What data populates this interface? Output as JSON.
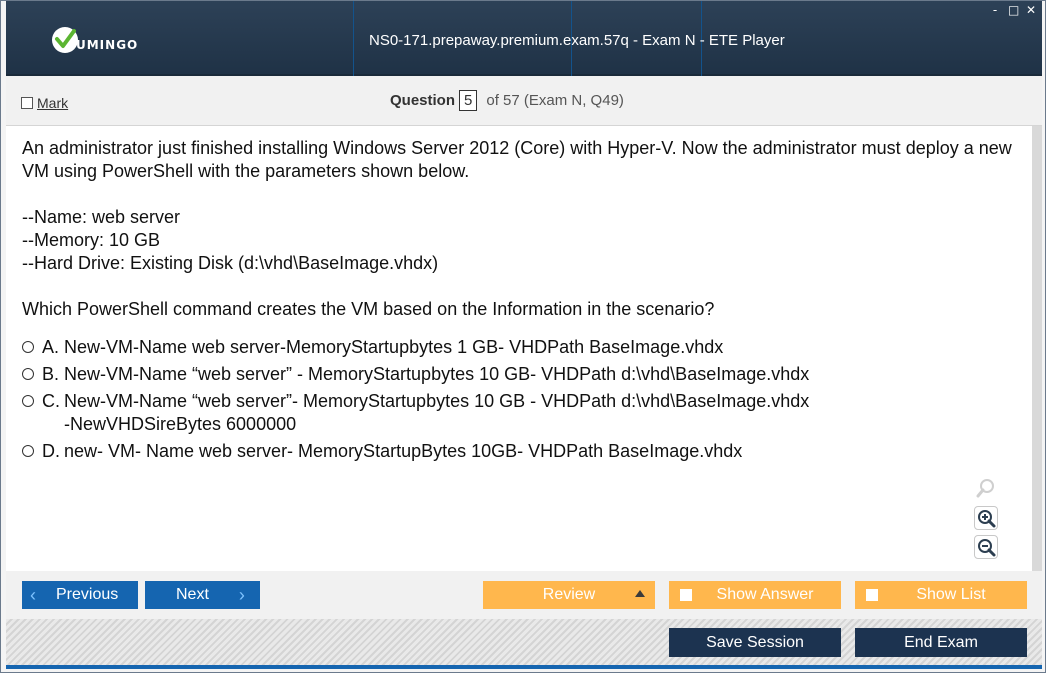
{
  "window": {
    "title": "NS0-171.prepaway.premium.exam.57q - Exam N - ETE Player",
    "logo_text": "UMINGO",
    "controls": [
      "-",
      "□",
      "✕"
    ]
  },
  "header": {
    "mark_label": "Mark",
    "question_label": "Question",
    "question_number": "5",
    "question_rest": "of 57 (Exam N, Q49)"
  },
  "question": {
    "text": "An administrator just finished installing Windows Server 2012 (Core) with Hyper-V. Now the administrator must deploy a new VM using PowerShell with the parameters shown below.\n\n--Name: web server\n--Memory: 10 GB\n--Hard Drive: Existing Disk (d:\\vhd\\BaseImage.vhdx)\n\nWhich PowerShell command creates the VM based on the Information in the scenario?",
    "answers": [
      {
        "letter": "A.",
        "text": "New-VM-Name web server-MemoryStartupbytes 1 GB- VHDPath BaseImage.vhdx"
      },
      {
        "letter": "B.",
        "text": "New-VM-Name “web server” - MemoryStartupbytes 10 GB- VHDPath d:\\vhd\\BaseImage.vhdx"
      },
      {
        "letter": "C.",
        "text": "New-VM-Name “web server”- MemoryStartupbytes 10 GB - VHDPath d:\\vhd\\BaseImage.vhdx\n-NewVHDSireBytes 6000000"
      },
      {
        "letter": "D.",
        "text": "new- VM- Name web server- MemoryStartupBytes 10GB- VHDPath BaseImage.vhdx"
      }
    ]
  },
  "nav": {
    "previous_label": "Previous",
    "next_label": "Next",
    "review_label": "Review",
    "show_answer_label": "Show Answer",
    "show_list_label": "Show List",
    "save_session_label": "Save Session",
    "end_exam_label": "End Exam"
  },
  "colors": {
    "titlebar": "#243a50",
    "nav_blue": "#1565b0",
    "orange": "#ffb74d",
    "dark_button": "#1c3350"
  }
}
